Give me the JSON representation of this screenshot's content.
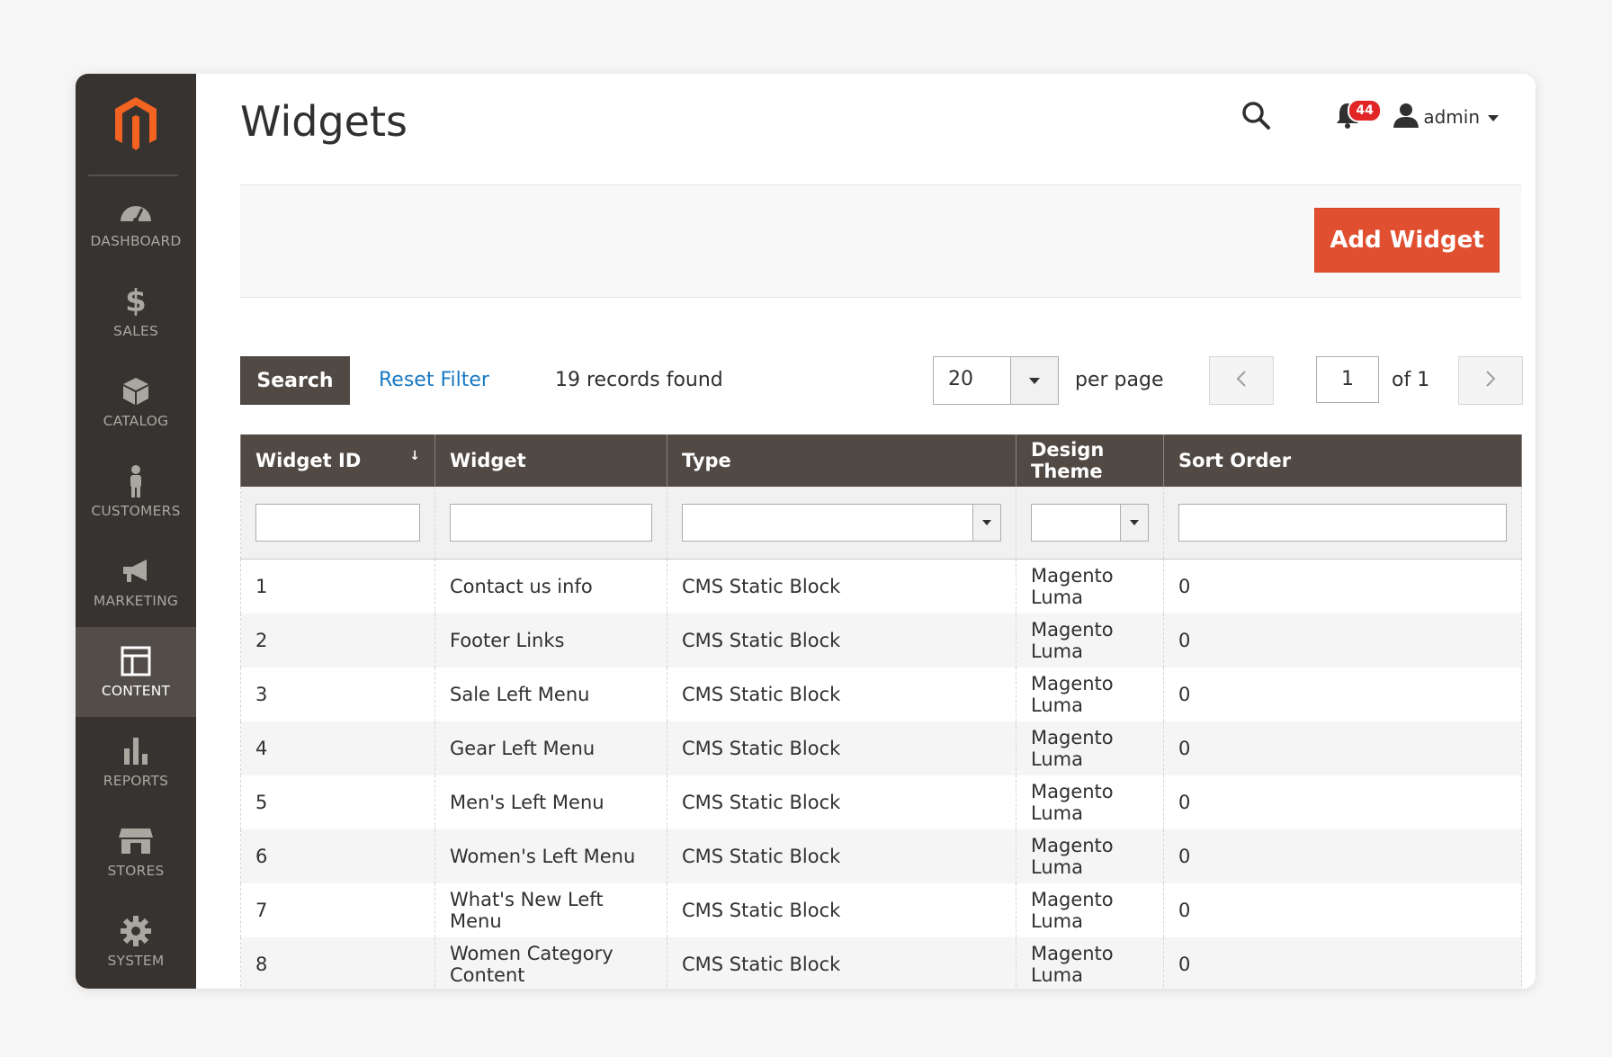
{
  "nav": {
    "items": [
      {
        "label": "DASHBOARD",
        "icon": "dashboard-icon"
      },
      {
        "label": "SALES",
        "icon": "dollar-icon"
      },
      {
        "label": "CATALOG",
        "icon": "box-icon"
      },
      {
        "label": "CUSTOMERS",
        "icon": "person-icon"
      },
      {
        "label": "MARKETING",
        "icon": "megaphone-icon"
      },
      {
        "label": "CONTENT",
        "icon": "layout-icon",
        "active": true
      },
      {
        "label": "REPORTS",
        "icon": "bar-chart-icon"
      },
      {
        "label": "STORES",
        "icon": "store-icon"
      },
      {
        "label": "SYSTEM",
        "icon": "gear-icon"
      }
    ]
  },
  "header": {
    "title": "Widgets",
    "notifications_count": "44",
    "user_name": "admin"
  },
  "toolbar": {
    "add_label": "Add Widget"
  },
  "grid": {
    "search_label": "Search",
    "reset_label": "Reset Filter",
    "records_text": "19 records found",
    "per_page_value": "20",
    "per_page_label": "per page",
    "current_page": "1",
    "page_of": "of 1"
  },
  "table": {
    "headers": [
      "Widget ID",
      "Widget",
      "Type",
      "Design Theme",
      "Sort Order"
    ],
    "sort_indicator": "↓",
    "rows": [
      [
        "1",
        "Contact us info",
        "CMS Static Block",
        "Magento Luma",
        "0"
      ],
      [
        "2",
        "Footer Links",
        "CMS Static Block",
        "Magento Luma",
        "0"
      ],
      [
        "3",
        "Sale Left Menu",
        "CMS Static Block",
        "Magento Luma",
        "0"
      ],
      [
        "4",
        "Gear Left Menu",
        "CMS Static Block",
        "Magento Luma",
        "0"
      ],
      [
        "5",
        "Men's Left Menu",
        "CMS Static Block",
        "Magento Luma",
        "0"
      ],
      [
        "6",
        "Women's Left Menu",
        "CMS Static Block",
        "Magento Luma",
        "0"
      ],
      [
        "7",
        "What's New Left Menu",
        "CMS Static Block",
        "Magento Luma",
        "0"
      ],
      [
        "8",
        "Women Category Content",
        "CMS Static Block",
        "Magento Luma",
        "0"
      ]
    ]
  },
  "colors": {
    "sidebar_bg": "#373330",
    "accent": "#e04f30",
    "header_bg": "#514943",
    "link": "#1979c3"
  }
}
